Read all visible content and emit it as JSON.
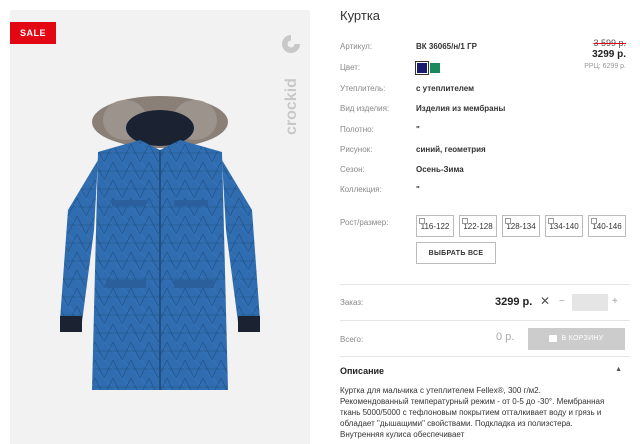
{
  "product": {
    "sale_badge": "SALE",
    "brand": "crockid",
    "title": "Куртка"
  },
  "specs": [
    {
      "label": "Артикул:",
      "value": "ВК 36065/н/1 ГР"
    },
    {
      "label": "Цвет:",
      "value": ""
    },
    {
      "label": "Утеплитель:",
      "value": "с утеплителем"
    },
    {
      "label": "Вид изделия:",
      "value": "Изделия из мембраны"
    },
    {
      "label": "Полотно:",
      "value": "\""
    },
    {
      "label": "Рисунок:",
      "value": "синий, геометрия"
    },
    {
      "label": "Сезон:",
      "value": "Осень-Зима"
    },
    {
      "label": "Коллекция:",
      "value": "\""
    }
  ],
  "price": {
    "old": "3 599 р.",
    "new": "3299 р.",
    "rrp": "РРЦ: 6299 р."
  },
  "colors": {
    "selected": "#1a1a6e",
    "alt": "#1b8a5a"
  },
  "sizes": {
    "label": "Рост/размер:",
    "options": [
      "116-122",
      "122-128",
      "128-134",
      "134-140",
      "140-146"
    ],
    "select_all": "ВЫБРАТЬ ВСЕ"
  },
  "order": {
    "label": "Заказ:",
    "price": "3299 р.",
    "remove": "✕",
    "minus": "−",
    "plus": "+",
    "qty": ""
  },
  "total": {
    "label": "Всего:",
    "value": "0 р.",
    "cart_button": "В КОРЗИНУ"
  },
  "description": {
    "title": "Описание",
    "toggle": "▲",
    "text": "Куртка для мальчика с утеплителем Fellex®, 300 г/м2. Рекомендованный температурный режим - от 0-5 до -30°. Мембранная ткань 5000/5000 с тефлоновым покрытием отталкивает воду и грязь и обладает \"дышащими\" свойствами. Подкладка из полиэстера. Внутренняя кулиса обеспечивает"
  }
}
